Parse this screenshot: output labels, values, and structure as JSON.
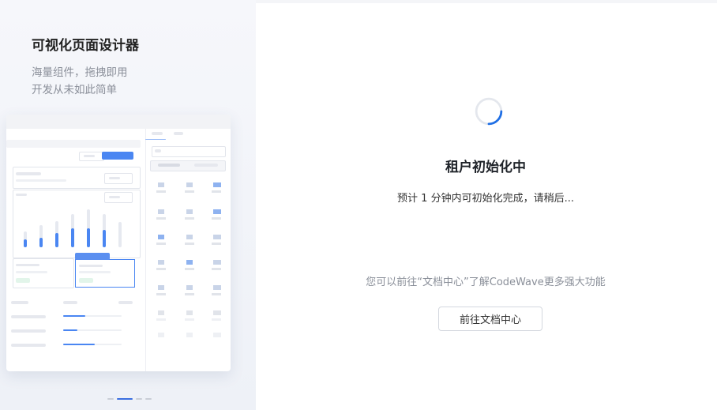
{
  "promo": {
    "title": "可视化页面设计器",
    "subtitle_line1": "海量组件，拖拽即用",
    "subtitle_line2": "开发从未如此简单",
    "carousel_total": 4,
    "carousel_active": 1
  },
  "status": {
    "title": "租户初始化中",
    "description": "预计 1 分钟内可初始化完成，请稍后...",
    "doc_hint": "您可以前往“文档中心”了解CodeWave更多强大功能",
    "doc_button_label": "前往文档中心"
  },
  "colors": {
    "accent": "#1f6fe5",
    "spinner_track": "#e4e7ed"
  }
}
